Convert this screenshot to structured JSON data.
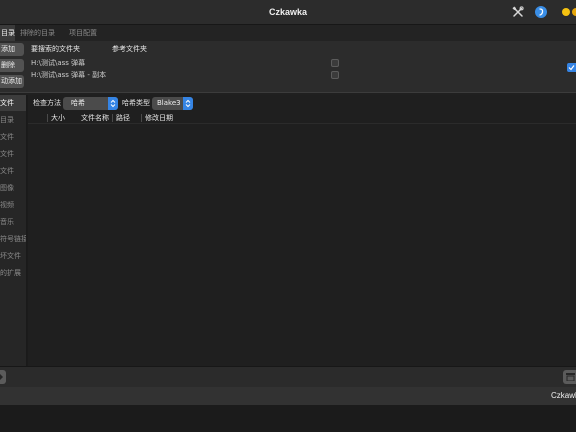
{
  "window": {
    "title": "Czkawka"
  },
  "title_bar": {
    "icons": [
      "tools-icon",
      "about-icon"
    ]
  },
  "tabs": [
    {
      "label": "目录",
      "active": true
    },
    {
      "label": "排除的目录",
      "active": false
    },
    {
      "label": "项目配置",
      "active": false
    }
  ],
  "folders": {
    "buttons": [
      {
        "label": "添加"
      },
      {
        "label": "删除"
      },
      {
        "label": "动添加"
      }
    ],
    "columns": {
      "search": "要搜索的文件夹",
      "reference": "参考文件夹"
    },
    "rows": [
      {
        "path": "H:\\测试\\ass 弹幕",
        "reference": false
      },
      {
        "path": "H:\\测试\\ass 弹幕 - 副本",
        "reference": false
      }
    ],
    "side_option_checked": true
  },
  "sidebar": {
    "items": [
      {
        "label": "文件",
        "active": true
      },
      {
        "label": "目录",
        "active": false
      },
      {
        "label": "文件",
        "active": false
      },
      {
        "label": "文件",
        "active": false
      },
      {
        "label": "文件",
        "active": false
      },
      {
        "label": "图像",
        "active": false
      },
      {
        "label": "视频",
        "active": false
      },
      {
        "label": "音乐",
        "active": false
      },
      {
        "label": "符号链接",
        "active": false
      },
      {
        "label": "坏文件",
        "active": false
      },
      {
        "label": "的扩展",
        "active": false
      }
    ]
  },
  "toolbar": {
    "check_method_label": "检查方法",
    "check_method_value": "哈希",
    "hash_type_label": "哈希类型",
    "hash_type_value": "Blake3"
  },
  "results": {
    "columns": [
      "大小",
      "文件名称",
      "路径",
      "修改日期"
    ],
    "rows": []
  },
  "bottom_bar": {
    "left_icon": "arrow-icon",
    "right_icon": "panel-icon"
  },
  "status": {
    "text": "Czkawka"
  },
  "colors": {
    "accent": "#3584e4",
    "minimize": "#f5c211",
    "maximize": "#e5a50a",
    "about": "#3a8ee6"
  }
}
